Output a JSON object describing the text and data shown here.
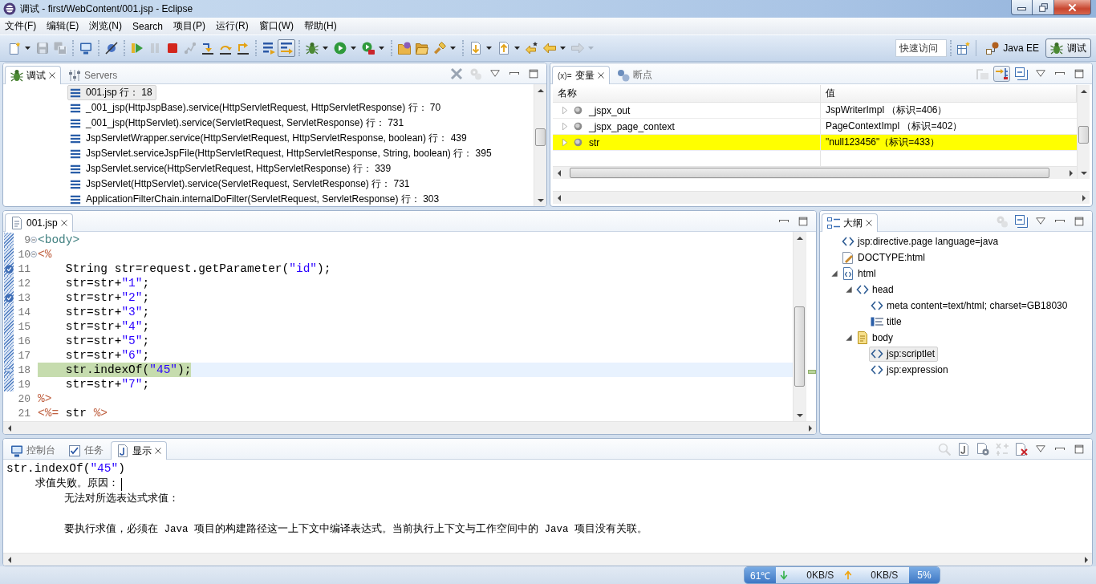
{
  "window": {
    "title": "调试 - first/WebContent/001.jsp - Eclipse"
  },
  "menu": [
    "文件(F)",
    "编辑(E)",
    "浏览(N)",
    "Search",
    "项目(P)",
    "运行(R)",
    "窗口(W)",
    "帮助(H)"
  ],
  "toolbar": {
    "groups": [
      {
        "buttons": [
          {
            "kind": "new",
            "dropdown": true,
            "disabled": false,
            "pressed": false
          },
          {
            "kind": "save",
            "dropdown": false,
            "disabled": true,
            "pressed": false
          },
          {
            "kind": "save_all",
            "dropdown": false,
            "disabled": true,
            "pressed": false
          }
        ]
      },
      {
        "buttons": [
          {
            "kind": "console",
            "dropdown": false,
            "disabled": false,
            "pressed": false
          }
        ]
      },
      {
        "buttons": [
          {
            "kind": "skip_breakpoints",
            "dropdown": false,
            "disabled": false,
            "pressed": false
          }
        ]
      },
      {
        "buttons": [
          {
            "kind": "resume",
            "dropdown": false,
            "disabled": false,
            "pressed": false
          },
          {
            "kind": "suspend",
            "dropdown": false,
            "disabled": true,
            "pressed": false
          },
          {
            "kind": "terminate",
            "dropdown": false,
            "disabled": false,
            "pressed": false
          },
          {
            "kind": "disconnect",
            "dropdown": false,
            "disabled": true,
            "pressed": false
          },
          {
            "kind": "step_into",
            "dropdown": false,
            "disabled": false,
            "pressed": false
          },
          {
            "kind": "step_over",
            "dropdown": false,
            "disabled": false,
            "pressed": false
          },
          {
            "kind": "step_return",
            "dropdown": false,
            "disabled": false,
            "pressed": false
          }
        ]
      },
      {
        "buttons": [
          {
            "kind": "drop_to_frame",
            "dropdown": false,
            "disabled": false,
            "pressed": false
          },
          {
            "kind": "step_filters",
            "dropdown": false,
            "disabled": false,
            "pressed": true
          }
        ]
      },
      {
        "buttons": [
          {
            "kind": "debug",
            "dropdown": true,
            "disabled": false,
            "pressed": false
          },
          {
            "kind": "run",
            "dropdown": true,
            "disabled": false,
            "pressed": false
          },
          {
            "kind": "external_tools",
            "dropdown": true,
            "disabled": false,
            "pressed": false
          }
        ]
      },
      {
        "buttons": [
          {
            "kind": "folder_type",
            "dropdown": false,
            "disabled": false,
            "pressed": false
          },
          {
            "kind": "folder",
            "dropdown": false,
            "disabled": false,
            "pressed": false
          },
          {
            "kind": "search",
            "dropdown": true,
            "disabled": false,
            "pressed": false
          }
        ]
      },
      {
        "buttons": [
          {
            "kind": "next_annotation",
            "dropdown": true,
            "disabled": false,
            "pressed": false
          },
          {
            "kind": "prev_annotation",
            "dropdown": true,
            "disabled": false,
            "pressed": false
          },
          {
            "kind": "last_edit",
            "dropdown": false,
            "disabled": false,
            "pressed": false
          },
          {
            "kind": "back",
            "dropdown": true,
            "disabled": false,
            "pressed": false
          },
          {
            "kind": "forward",
            "dropdown": true,
            "disabled": true,
            "pressed": false
          }
        ]
      }
    ],
    "quick_access": {
      "placeholder": "快速访问"
    },
    "perspectives": [
      {
        "label": "Java EE",
        "kind": "javaee",
        "selected": false
      },
      {
        "label": "调试",
        "kind": "debug",
        "selected": true
      }
    ]
  },
  "debug_view": {
    "tabs": [
      {
        "label": "调试",
        "kind": "debug",
        "selected": true
      },
      {
        "label": "Servers",
        "kind": "servers",
        "selected": false
      }
    ],
    "actions": [
      {
        "kind": "remove_terminated",
        "disabled": false,
        "pressed": false
      },
      {
        "kind": "gears",
        "disabled": true,
        "pressed": false
      }
    ],
    "frames": [
      {
        "label": "001.jsp 行： 18",
        "selected": true
      },
      {
        "label": "_001_jsp(HttpJspBase).service(HttpServletRequest, HttpServletResponse) 行： 70",
        "selected": false
      },
      {
        "label": "_001_jsp(HttpServlet).service(ServletRequest, ServletResponse) 行： 731",
        "selected": false
      },
      {
        "label": "JspServletWrapper.service(HttpServletRequest, HttpServletResponse, boolean) 行： 439",
        "selected": false
      },
      {
        "label": "JspServlet.serviceJspFile(HttpServletRequest, HttpServletResponse, String, boolean) 行： 395",
        "selected": false
      },
      {
        "label": "JspServlet.service(HttpServletRequest, HttpServletResponse) 行： 339",
        "selected": false
      },
      {
        "label": "JspServlet(HttpServlet).service(ServletRequest, ServletResponse) 行： 731",
        "selected": false
      },
      {
        "label": "ApplicationFilterChain.internalDoFilter(ServletRequest, ServletResponse) 行： 303",
        "selected": false
      }
    ]
  },
  "variables_view": {
    "tabs": [
      {
        "label": "变量",
        "glyph": "(x)=",
        "selected": true
      },
      {
        "label": "断点",
        "kind": "breakpoints",
        "selected": false
      }
    ],
    "actions": [
      {
        "kind": "type_names",
        "disabled": true,
        "pressed": false
      },
      {
        "kind": "logical_structure",
        "disabled": false,
        "pressed": true
      },
      {
        "kind": "collapse_all",
        "disabled": false,
        "pressed": false
      }
    ],
    "columns": [
      "名称",
      "值"
    ],
    "rows": [
      {
        "name": "_jspx_out",
        "value": "JspWriterImpl （标识=406）",
        "expanded": false,
        "changed": false
      },
      {
        "name": "_jspx_page_context",
        "value": "PageContextImpl （标识=402）",
        "expanded": false,
        "changed": false
      },
      {
        "name": "str",
        "value": "\"null123456\"（标识=433）",
        "expanded": false,
        "changed": true
      }
    ]
  },
  "editor": {
    "tabs": [
      {
        "label": "001.jsp",
        "kind": "jsp_file",
        "selected": true
      }
    ],
    "lines": [
      {
        "number": "9",
        "tokens": [
          {
            "kind": "tag",
            "text": "<body>"
          }
        ],
        "fold": true,
        "breakpoint": false,
        "current": false,
        "changed": true
      },
      {
        "number": "10",
        "tokens": [
          {
            "kind": "jsp",
            "text": "<%"
          }
        ],
        "fold": true,
        "breakpoint": false,
        "current": false,
        "changed": true
      },
      {
        "number": "11",
        "tokens": [
          {
            "kind": "plain",
            "text": "    String str=request.getParameter("
          },
          {
            "kind": "string",
            "text": "\"id\""
          },
          {
            "kind": "plain",
            "text": ");"
          }
        ],
        "fold": false,
        "breakpoint": true,
        "current": false,
        "changed": true
      },
      {
        "number": "12",
        "tokens": [
          {
            "kind": "plain",
            "text": "    str=str+"
          },
          {
            "kind": "string",
            "text": "\"1\""
          },
          {
            "kind": "plain",
            "text": ";"
          }
        ],
        "fold": false,
        "breakpoint": false,
        "current": false,
        "changed": true
      },
      {
        "number": "13",
        "tokens": [
          {
            "kind": "plain",
            "text": "    str=str+"
          },
          {
            "kind": "string",
            "text": "\"2\""
          },
          {
            "kind": "plain",
            "text": ";"
          }
        ],
        "fold": false,
        "breakpoint": true,
        "current": false,
        "changed": true
      },
      {
        "number": "14",
        "tokens": [
          {
            "kind": "plain",
            "text": "    str=str+"
          },
          {
            "kind": "string",
            "text": "\"3\""
          },
          {
            "kind": "plain",
            "text": ";"
          }
        ],
        "fold": false,
        "breakpoint": false,
        "current": false,
        "changed": true
      },
      {
        "number": "15",
        "tokens": [
          {
            "kind": "plain",
            "text": "    str=str+"
          },
          {
            "kind": "string",
            "text": "\"4\""
          },
          {
            "kind": "plain",
            "text": ";"
          }
        ],
        "fold": false,
        "breakpoint": false,
        "current": false,
        "changed": true
      },
      {
        "number": "16",
        "tokens": [
          {
            "kind": "plain",
            "text": "    str=str+"
          },
          {
            "kind": "string",
            "text": "\"5\""
          },
          {
            "kind": "plain",
            "text": ";"
          }
        ],
        "fold": false,
        "breakpoint": false,
        "current": false,
        "changed": true
      },
      {
        "number": "17",
        "tokens": [
          {
            "kind": "plain",
            "text": "    str=str+"
          },
          {
            "kind": "string",
            "text": "\"6\""
          },
          {
            "kind": "plain",
            "text": ";"
          }
        ],
        "fold": false,
        "breakpoint": false,
        "current": false,
        "changed": true
      },
      {
        "number": "18",
        "tokens": [
          {
            "kind": "plain",
            "text": "    str.indexOf("
          },
          {
            "kind": "string",
            "text": "\"45\""
          },
          {
            "kind": "plain",
            "text": ");"
          }
        ],
        "fold": false,
        "breakpoint": false,
        "current": true,
        "changed": true
      },
      {
        "number": "19",
        "tokens": [
          {
            "kind": "plain",
            "text": "    str=str+"
          },
          {
            "kind": "string",
            "text": "\"7\""
          },
          {
            "kind": "plain",
            "text": ";"
          }
        ],
        "fold": false,
        "breakpoint": false,
        "current": false,
        "changed": true
      },
      {
        "number": "20",
        "tokens": [
          {
            "kind": "jsp",
            "text": "%>"
          }
        ],
        "fold": false,
        "breakpoint": false,
        "current": false,
        "changed": false
      },
      {
        "number": "21",
        "tokens": [
          {
            "kind": "jsp",
            "text": "<%="
          },
          {
            "kind": "plain",
            "text": " str "
          },
          {
            "kind": "jsp",
            "text": "%>"
          }
        ],
        "fold": false,
        "breakpoint": false,
        "current": false,
        "changed": false
      }
    ]
  },
  "outline": {
    "tabs": [
      {
        "label": "大纲",
        "kind": "outline",
        "selected": true
      }
    ],
    "actions": [
      {
        "kind": "gears",
        "disabled": true,
        "pressed": false
      },
      {
        "kind": "collapse_all",
        "disabled": false,
        "pressed": false
      }
    ],
    "tree": [
      {
        "label": "jsp:directive.page language=java",
        "kind": "tag",
        "expanded": false,
        "selected": false
      },
      {
        "label": "DOCTYPE:html",
        "kind": "doctype",
        "expanded": false,
        "selected": false
      },
      {
        "label": "html",
        "kind": "html",
        "expanded": true,
        "selected": false,
        "children": [
          {
            "label": "head",
            "kind": "tag",
            "expanded": true,
            "selected": false,
            "children": [
              {
                "label": "meta content=text/html; charset=GB18030",
                "kind": "tag",
                "expanded": false,
                "selected": false
              },
              {
                "label": "title",
                "kind": "title",
                "expanded": false,
                "selected": false
              }
            ]
          },
          {
            "label": "body",
            "kind": "body",
            "expanded": true,
            "selected": false,
            "children": [
              {
                "label": "jsp:scriptlet",
                "kind": "tag",
                "expanded": false,
                "selected": true
              },
              {
                "label": "jsp:expression",
                "kind": "tag",
                "expanded": false,
                "selected": false
              }
            ]
          }
        ]
      }
    ]
  },
  "bottom_view": {
    "tabs": [
      {
        "label": "控制台",
        "kind": "console",
        "selected": false
      },
      {
        "label": "任务",
        "kind": "tasks",
        "selected": false
      },
      {
        "label": "显示",
        "kind": "display",
        "selected": true
      }
    ],
    "actions": [
      {
        "kind": "find",
        "disabled": true,
        "pressed": false
      },
      {
        "kind": "java_page",
        "disabled": false,
        "pressed": false
      },
      {
        "kind": "page_gear",
        "disabled": false,
        "pressed": false
      },
      {
        "kind": "expression",
        "disabled": true,
        "pressed": false
      },
      {
        "kind": "clear",
        "disabled": false,
        "pressed": false
      }
    ],
    "output": [
      {
        "tokens": [
          {
            "kind": "plain",
            "text": "str.indexOf("
          },
          {
            "kind": "string",
            "text": "\"45\""
          },
          {
            "kind": "plain",
            "text": ")"
          }
        ],
        "caret": false,
        "children": [
          {
            "text": "求值失败。原因：",
            "caret": true,
            "children": [
              {
                "text": "无法对所选表达式求值：",
                "detail": "要执行求值，必须在 Java 项目的构建路径这一上下文中编译表达式。当前执行上下文与工作空间中的 Java 项目没有关联。",
                "caret": false
              }
            ]
          }
        ]
      }
    ]
  },
  "system_monitor": {
    "temperature": "61℃",
    "download": "0KB/S",
    "upload": "0KB/S",
    "cpu": "5%"
  }
}
